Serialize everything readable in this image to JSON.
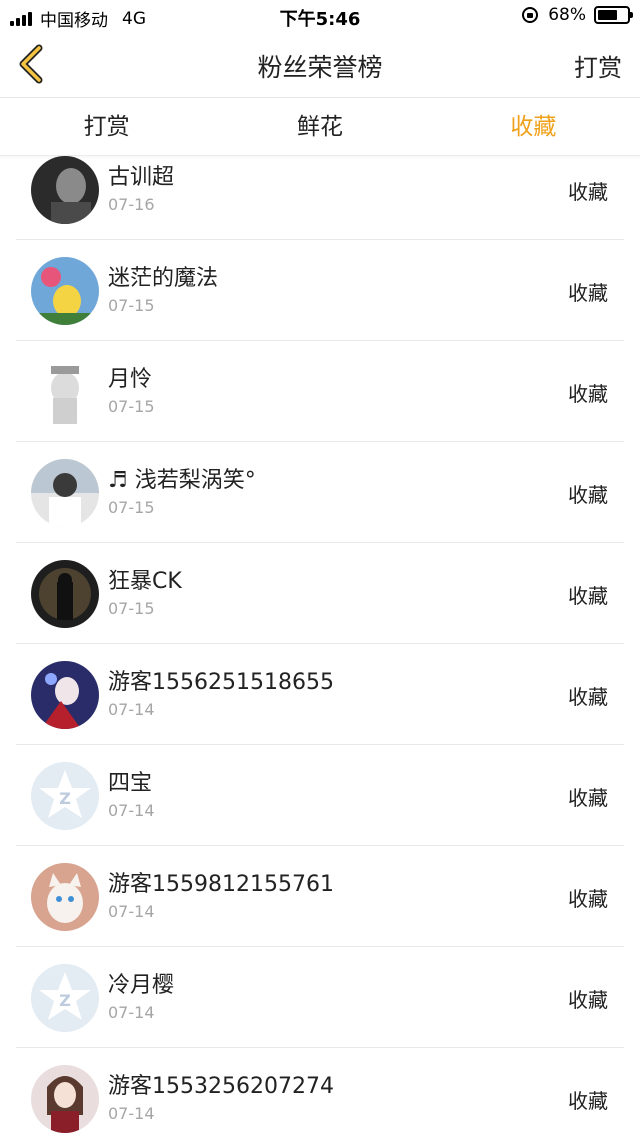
{
  "status_bar": {
    "carrier": "中国移动",
    "network": "4G",
    "time": "下午5:46",
    "battery": "68%",
    "battery_level": 0.68
  },
  "nav": {
    "title": "粉丝荣誉榜",
    "action": "打赏",
    "back_icon": "chevron-left-icon"
  },
  "tabs": [
    {
      "label": "打赏",
      "active": false
    },
    {
      "label": "鲜花",
      "active": false
    },
    {
      "label": "收藏",
      "active": true
    }
  ],
  "colors": {
    "accent": "#f0a11b",
    "divider": "#e9e9e9",
    "secondary_text": "#a6a6a6"
  },
  "fans": [
    {
      "name": "古训超",
      "date": "07-16",
      "action": "收藏",
      "avatar": "photo"
    },
    {
      "name": "迷茫的魔法",
      "date": "07-15",
      "action": "收藏",
      "avatar": "photo"
    },
    {
      "name": "月怜",
      "date": "07-15",
      "action": "收藏",
      "avatar": "photo"
    },
    {
      "name": "♬ 浅若梨涡笑°",
      "date": "07-15",
      "action": "收藏",
      "avatar": "photo"
    },
    {
      "name": "狂暴CK",
      "date": "07-15",
      "action": "收藏",
      "avatar": "photo"
    },
    {
      "name": "游客1556251518655",
      "date": "07-14",
      "action": "收藏",
      "avatar": "photo"
    },
    {
      "name": "四宝",
      "date": "07-14",
      "action": "收藏",
      "avatar": "default"
    },
    {
      "name": "游客1559812155761",
      "date": "07-14",
      "action": "收藏",
      "avatar": "photo"
    },
    {
      "name": "冷月樱",
      "date": "07-14",
      "action": "收藏",
      "avatar": "default"
    },
    {
      "name": "游客1553256207274",
      "date": "07-14",
      "action": "收藏",
      "avatar": "photo"
    }
  ]
}
